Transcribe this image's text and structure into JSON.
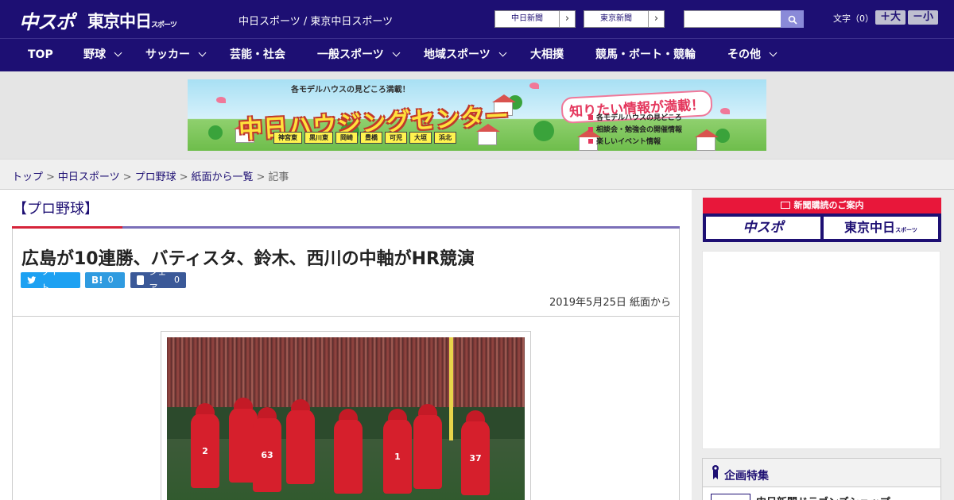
{
  "header": {
    "logo_chuspo": "中スポ",
    "logo_tokyo": "東京中日",
    "logo_tokyo_small": "スポーツ",
    "site_links": "中日スポーツ / 東京中日スポーツ",
    "ext_chunichi": "中日新聞",
    "ext_tokyo": "東京新聞",
    "search_placeholder": "",
    "font_size_label": "文字（0）",
    "font_bigger": "＋大",
    "font_smaller": "－小"
  },
  "nav": {
    "items": [
      {
        "label": "TOP"
      },
      {
        "label": "野球"
      },
      {
        "label": "サッカー"
      },
      {
        "label": "芸能・社会"
      },
      {
        "label": "一般スポーツ"
      },
      {
        "label": "地域スポーツ"
      },
      {
        "label": "大相撲"
      },
      {
        "label": "競馬・ボート・競輪"
      },
      {
        "label": "その他"
      }
    ]
  },
  "banner": {
    "sub": "各モデルハウスの見どころ満載！",
    "title": "中日ハウジングセンター",
    "cities": [
      "神宮東",
      "黒川東",
      "岡崎",
      "豊橋",
      "可児",
      "大垣",
      "浜北"
    ],
    "right_title": "知りたい情報が満載！",
    "list": [
      "各モデルハウスの見どころ",
      "相談会・勉強会の開催情報",
      "楽しいイベント情報"
    ]
  },
  "breadcrumb": {
    "items": [
      "トップ",
      "中日スポーツ",
      "プロ野球",
      "紙面から一覧"
    ],
    "current": "記事",
    "sep": ">"
  },
  "article": {
    "category": "【プロ野球】",
    "title": "広島が10連勝、バティスタ、鈴木、西川の中軸がHR競演",
    "share_tweet": "ツイート",
    "share_hatena_label": "B!",
    "share_hatena_count": "0",
    "share_fb": "シェア",
    "share_fb_count": "0",
    "date": "2019年5月25日 紙面から"
  },
  "sidebar": {
    "subscribe_head": "新聞購読のご案内",
    "subscribe_chuspo": "中スポ",
    "subscribe_tokyo": "東京中日",
    "subscribe_tokyo_small": "スポーツ",
    "feature_title": "企画特集",
    "feature_item": "中日新聞ドラゴンズショップ"
  },
  "colors": {
    "brand_navy": "#1d0f73",
    "accent_red": "#d6243a",
    "twitter": "#1da1f2",
    "hatena": "#2f9be0",
    "facebook": "#3b5998"
  }
}
